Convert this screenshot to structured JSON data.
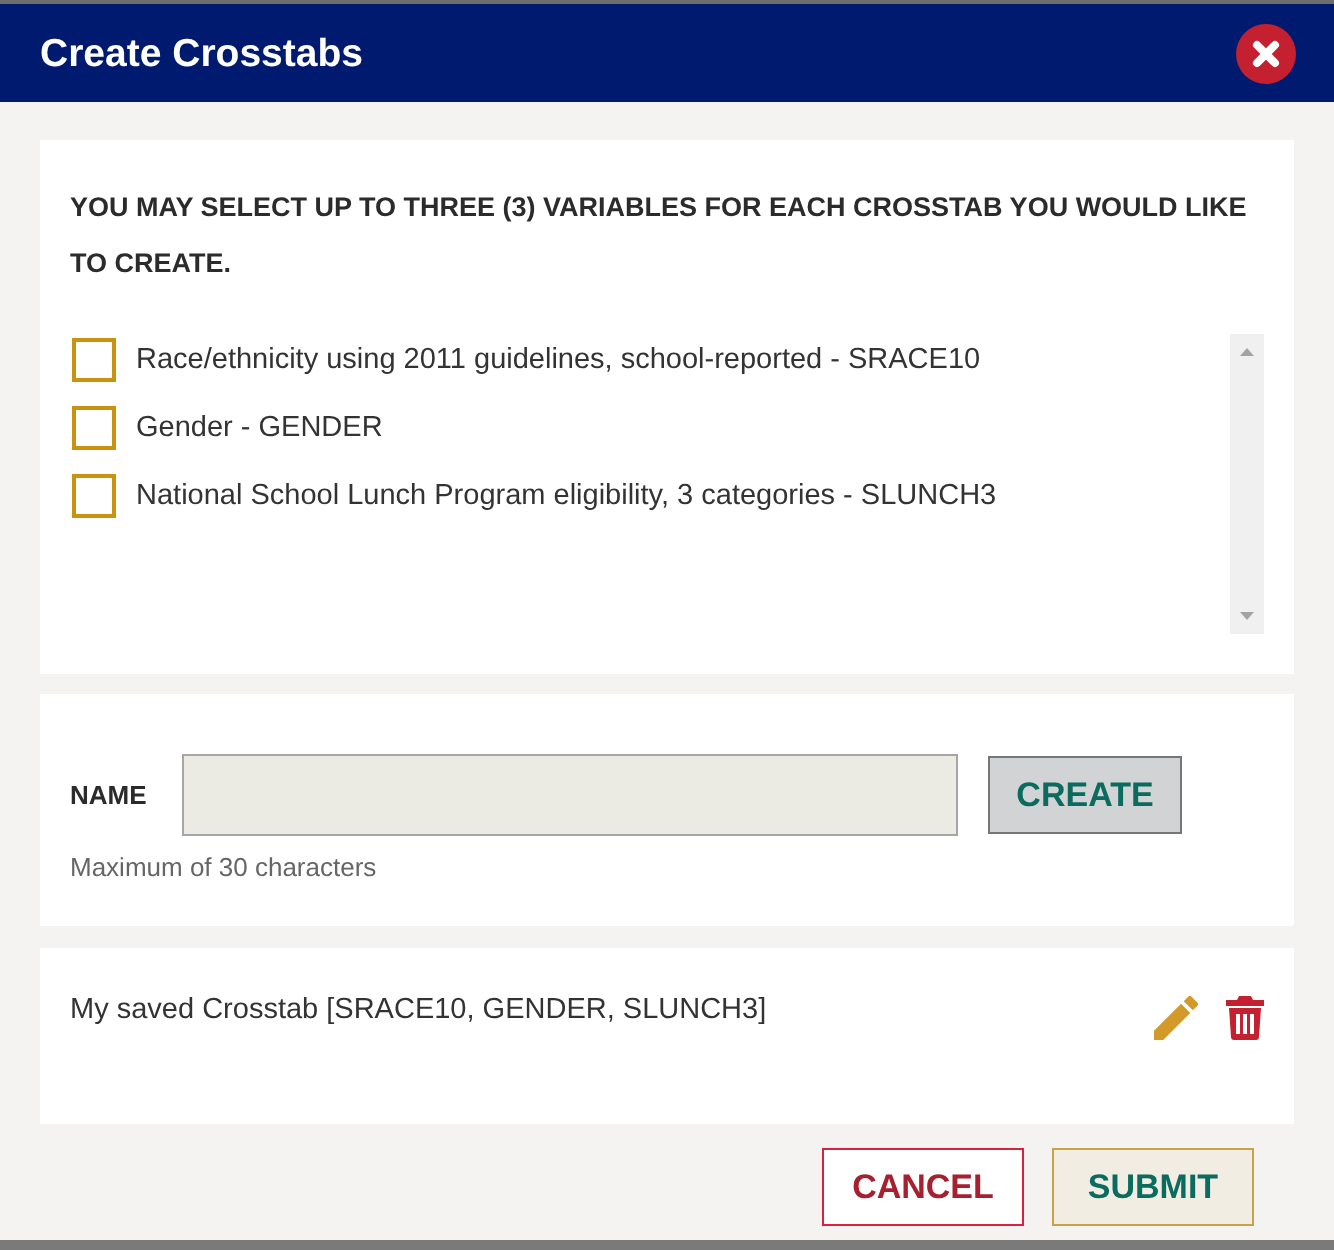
{
  "dialog": {
    "title": "Create Crosstabs"
  },
  "instructions": "YOU MAY SELECT UP TO THREE (3) VARIABLES FOR EACH CROSSTAB YOU WOULD LIKE TO CREATE.",
  "variables": [
    {
      "label": "Race/ethnicity using 2011 guidelines, school-reported - SRACE10",
      "checked": false
    },
    {
      "label": "Gender - GENDER",
      "checked": false
    },
    {
      "label": "National School Lunch Program eligibility, 3 categories - SLUNCH3",
      "checked": false
    }
  ],
  "name_form": {
    "label": "NAME",
    "button": "CREATE",
    "hint": "Maximum of 30 characters"
  },
  "saved_crosstabs": [
    {
      "label": "My saved Crosstab [SRACE10, GENDER, SLUNCH3]"
    }
  ],
  "buttons": [
    {
      "label": "CANCEL",
      "kind": "cancel"
    },
    {
      "label": "SUBMIT",
      "kind": "submit"
    }
  ]
}
